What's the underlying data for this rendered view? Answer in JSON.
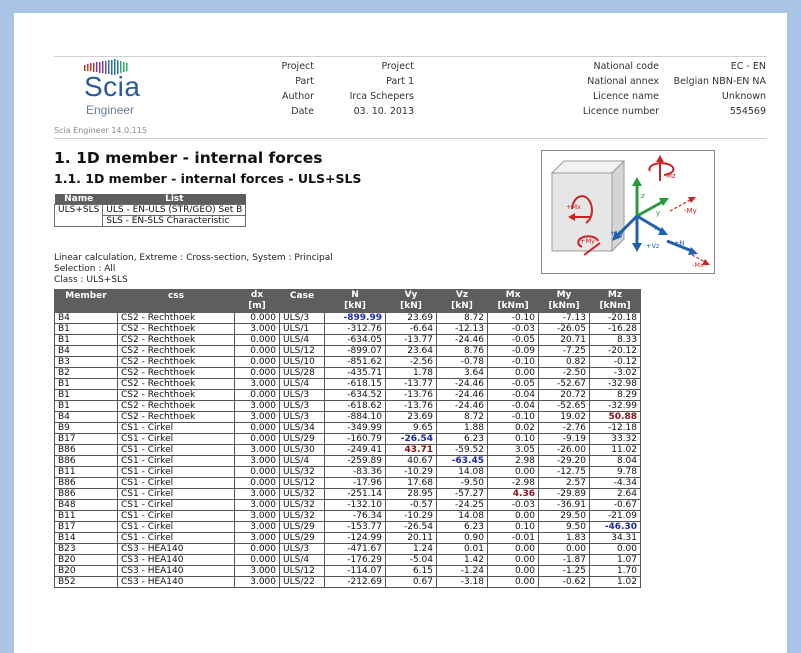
{
  "logo": {
    "word": "Scia",
    "sub": "Engineer",
    "version": "Scia Engineer 14.0.115"
  },
  "project_info": [
    {
      "label": "Project",
      "value": "Project"
    },
    {
      "label": "Part",
      "value": "Part 1"
    },
    {
      "label": "Author",
      "value": "Irca Schepers"
    },
    {
      "label": "Date",
      "value": "03. 10. 2013"
    }
  ],
  "code_info": [
    {
      "label": "National code",
      "value": "EC - EN"
    },
    {
      "label": "National annex",
      "value": "Belgian NBN-EN NA"
    },
    {
      "label": "Licence name",
      "value": "Unknown"
    },
    {
      "label": "Licence number",
      "value": "554569"
    }
  ],
  "title": "1. 1D member - internal forces",
  "subtitle": "1.1. 1D member - internal forces - ULS+SLS",
  "combo_table": {
    "headers": [
      "Name",
      "List"
    ],
    "name": "ULS+SLS",
    "list": [
      "ULS - EN-ULS (STR/GEO) Set B",
      "SLS - EN-SLS Characteristic"
    ]
  },
  "calc_info": [
    "Linear calculation, Extreme : Cross-section, System : Principal",
    "Selection : All",
    "Class : ULS+SLS"
  ],
  "diagram": {
    "labels": {
      "mz": "Mz",
      "my": "-My",
      "mx_pos": "+Mx",
      "my_pos": "+My",
      "vz": "+Vz",
      "vy": "+Vy",
      "n": "+N",
      "mx_neg": "-Mx",
      "z": "z",
      "y": "y",
      "x": "x"
    }
  },
  "forces_table": {
    "headers": [
      {
        "l1": "Member",
        "l2": ""
      },
      {
        "l1": "css",
        "l2": ""
      },
      {
        "l1": "dx",
        "l2": "[m]"
      },
      {
        "l1": "Case",
        "l2": ""
      },
      {
        "l1": "N",
        "l2": "[kN]"
      },
      {
        "l1": "Vy",
        "l2": "[kN]"
      },
      {
        "l1": "Vz",
        "l2": "[kN]"
      },
      {
        "l1": "Mx",
        "l2": "[kNm]"
      },
      {
        "l1": "My",
        "l2": "[kNm]"
      },
      {
        "l1": "Mz",
        "l2": "[kNm]"
      }
    ],
    "rows": [
      [
        "B4",
        "CS2 - Rechthoek",
        "0.000",
        "ULS/3",
        "-899.99",
        "23.69",
        "8.72",
        "-0.10",
        "-7.13",
        "-20.18"
      ],
      [
        "B1",
        "CS2 - Rechthoek",
        "3.000",
        "ULS/1",
        "-312.76",
        "-6.64",
        "-12.13",
        "-0.03",
        "-26.05",
        "-16.28"
      ],
      [
        "B1",
        "CS2 - Rechthoek",
        "0.000",
        "ULS/4",
        "-634.05",
        "-13.77",
        "-24.46",
        "-0.05",
        "20.71",
        "8.33"
      ],
      [
        "B4",
        "CS2 - Rechthoek",
        "0.000",
        "ULS/12",
        "-899.07",
        "23.64",
        "8.76",
        "-0.09",
        "-7.25",
        "-20.12"
      ],
      [
        "B3",
        "CS2 - Rechthoek",
        "0.000",
        "ULS/10",
        "-851.62",
        "-2.56",
        "-0.78",
        "-0.10",
        "0.82",
        "-0.12"
      ],
      [
        "B2",
        "CS2 - Rechthoek",
        "0.000",
        "ULS/28",
        "-435.71",
        "1.78",
        "3.64",
        "0.00",
        "-2.50",
        "-3.02"
      ],
      [
        "B1",
        "CS2 - Rechthoek",
        "3.000",
        "ULS/4",
        "-618.15",
        "-13.77",
        "-24.46",
        "-0.05",
        "-52.67",
        "-32.98"
      ],
      [
        "B1",
        "CS2 - Rechthoek",
        "0.000",
        "ULS/3",
        "-634.52",
        "-13.76",
        "-24.46",
        "-0.04",
        "20.72",
        "8.29"
      ],
      [
        "B1",
        "CS2 - Rechthoek",
        "3.000",
        "ULS/3",
        "-618.62",
        "-13.76",
        "-24.46",
        "-0.04",
        "-52.65",
        "-32.99"
      ],
      [
        "B4",
        "CS2 - Rechthoek",
        "3.000",
        "ULS/3",
        "-884.10",
        "23.69",
        "8.72",
        "-0.10",
        "19.02",
        "50.88"
      ],
      [
        "B9",
        "CS1 - Cirkel",
        "0.000",
        "ULS/34",
        "-349.99",
        "9.65",
        "1.88",
        "0.02",
        "-2.76",
        "-12.18"
      ],
      [
        "B17",
        "CS1 - Cirkel",
        "0.000",
        "ULS/29",
        "-160.79",
        "-26.54",
        "6.23",
        "0.10",
        "-9.19",
        "33.32"
      ],
      [
        "B86",
        "CS1 - Cirkel",
        "3.000",
        "ULS/30",
        "-249.41",
        "43.71",
        "-59.52",
        "3.05",
        "-26.00",
        "11.02"
      ],
      [
        "B86",
        "CS1 - Cirkel",
        "3.000",
        "ULS/4",
        "-259.89",
        "40.67",
        "-63.45",
        "2.98",
        "-29.20",
        "8.04"
      ],
      [
        "B11",
        "CS1 - Cirkel",
        "0.000",
        "ULS/32",
        "-83.36",
        "-10.29",
        "14.08",
        "0.00",
        "-12.75",
        "9.78"
      ],
      [
        "B86",
        "CS1 - Cirkel",
        "0.000",
        "ULS/12",
        "-17.96",
        "17.68",
        "-9.50",
        "-2.98",
        "2.57",
        "-4.34"
      ],
      [
        "B86",
        "CS1 - Cirkel",
        "3.000",
        "ULS/32",
        "-251.14",
        "28.95",
        "-57.27",
        "4.36",
        "-29.89",
        "2.64"
      ],
      [
        "B48",
        "CS1 - Cirkel",
        "3.000",
        "ULS/32",
        "-132.10",
        "-0.57",
        "-24.25",
        "-0.03",
        "-36.91",
        "-0.67"
      ],
      [
        "B11",
        "CS1 - Cirkel",
        "3.000",
        "ULS/32",
        "-76.34",
        "-10.29",
        "14.08",
        "0.00",
        "29.50",
        "-21.09"
      ],
      [
        "B17",
        "CS1 - Cirkel",
        "3.000",
        "ULS/29",
        "-153.77",
        "-26.54",
        "6.23",
        "0.10",
        "9.50",
        "-46.30"
      ],
      [
        "B14",
        "CS1 - Cirkel",
        "3.000",
        "ULS/29",
        "-124.99",
        "20.11",
        "0.90",
        "-0.01",
        "1.83",
        "34.31"
      ],
      [
        "B23",
        "CS3 - HEA140",
        "0.000",
        "ULS/3",
        "-471.67",
        "1.24",
        "0.01",
        "0.00",
        "0.00",
        "0.00"
      ],
      [
        "B20",
        "CS3 - HEA140",
        "0.000",
        "ULS/4",
        "-176.29",
        "-5.04",
        "1.42",
        "0.00",
        "-1.87",
        "1.07"
      ],
      [
        "B20",
        "CS3 - HEA140",
        "3.000",
        "ULS/12",
        "-114.07",
        "6.15",
        "-1.24",
        "0.00",
        "-1.25",
        "1.70"
      ],
      [
        "B52",
        "CS3 - HEA140",
        "3.000",
        "ULS/22",
        "-212.69",
        "0.67",
        "-3.18",
        "0.00",
        "-0.62",
        "1.02"
      ]
    ],
    "highlights": {
      "blue": [
        [
          0,
          4
        ],
        [
          11,
          5
        ],
        [
          13,
          6
        ],
        [
          19,
          9
        ]
      ],
      "red": [
        [
          9,
          9
        ],
        [
          12,
          5
        ],
        [
          16,
          7
        ]
      ]
    }
  }
}
